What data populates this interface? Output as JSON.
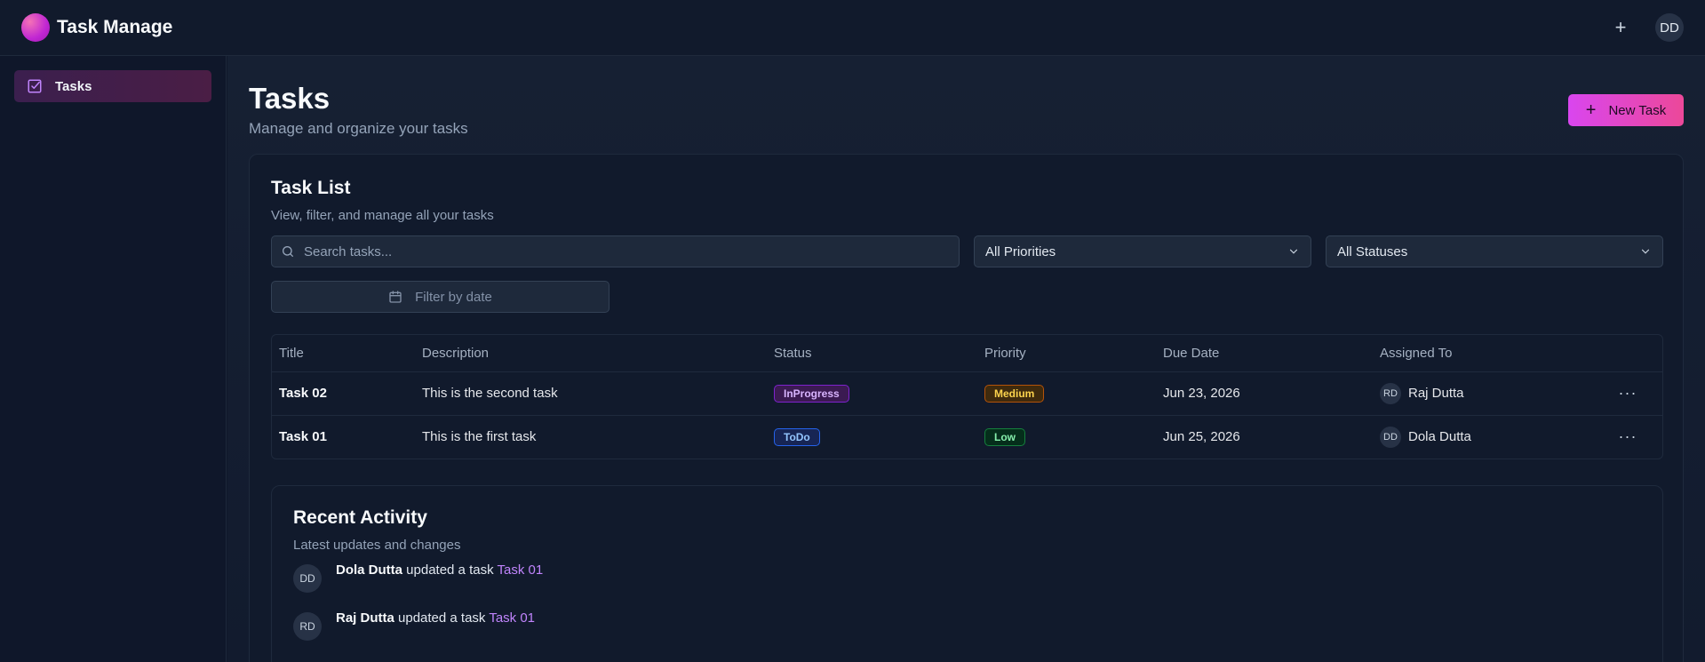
{
  "app": {
    "title": "Task Manage",
    "user_initials": "DD",
    "add_label": "+"
  },
  "sidebar": {
    "items": [
      {
        "label": "Tasks",
        "icon": "checkbox-icon",
        "active": true
      }
    ]
  },
  "page": {
    "title": "Tasks",
    "subtitle": "Manage and organize your tasks",
    "new_task_label": "New Task"
  },
  "task_list": {
    "title": "Task List",
    "subtitle": "View, filter, and manage all your tasks",
    "search_placeholder": "Search tasks...",
    "priority_filter": "All Priorities",
    "status_filter": "All Statuses",
    "date_filter": "Filter by date",
    "columns": [
      "Title",
      "Description",
      "Status",
      "Priority",
      "Due Date",
      "Assigned To"
    ],
    "rows": [
      {
        "title": "Task 02",
        "description": "This is the second task",
        "status": "InProgress",
        "priority": "Medium",
        "due": "Jun 23, 2026",
        "initials": "RD",
        "assignee": "Raj Dutta",
        "menu": "···"
      },
      {
        "title": "Task 01",
        "description": "This is the first task",
        "status": "ToDo",
        "priority": "Low",
        "due": "Jun 25, 2026",
        "initials": "DD",
        "assignee": "Dola Dutta",
        "menu": "···"
      }
    ]
  },
  "activity": {
    "title": "Recent Activity",
    "subtitle": "Latest updates and changes",
    "items": [
      {
        "initials": "DD",
        "user": "Dola Dutta",
        "action": " updated a task ",
        "target": "Task 01"
      },
      {
        "initials": "RD",
        "user": "Raj Dutta",
        "action": " updated a task ",
        "target": "Task 01"
      }
    ]
  },
  "colors": {
    "accent": "#d946ef",
    "accent2": "#ec4899",
    "background": "#0f172a"
  }
}
